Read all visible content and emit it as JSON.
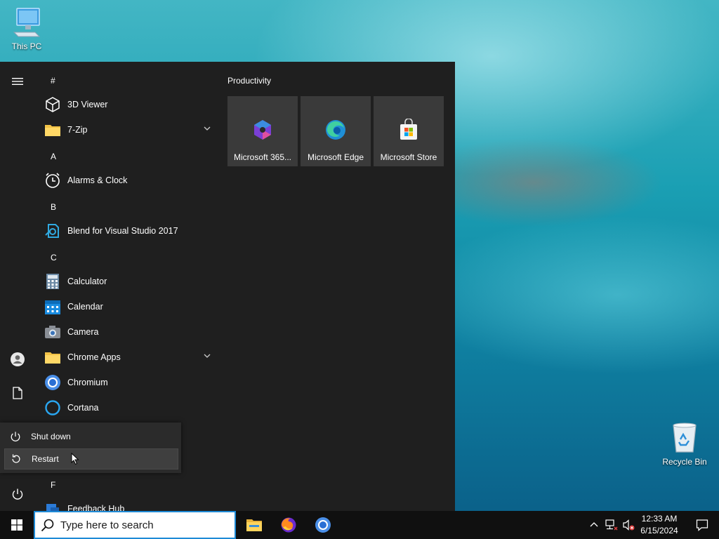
{
  "desktop": {
    "icons": [
      {
        "label": "This PC",
        "icon": "computer-icon"
      },
      {
        "label": "Recycle Bin",
        "icon": "recycle-bin-icon"
      }
    ]
  },
  "start_menu": {
    "rail": {
      "menu_icon": "hamburger-icon",
      "user_icon": "user-icon",
      "documents_icon": "document-icon",
      "power_icon": "power-icon"
    },
    "app_list": {
      "letters": [
        "#",
        "A",
        "B",
        "C",
        "F"
      ],
      "apps": [
        {
          "name": "3D Viewer",
          "icon": "cube-icon"
        },
        {
          "name": "7-Zip",
          "icon": "folder-icon",
          "expandable": true
        },
        {
          "name": "Alarms & Clock",
          "icon": "alarm-clock-icon"
        },
        {
          "name": "Blend for Visual Studio 2017",
          "icon": "blend-icon"
        },
        {
          "name": "Calculator",
          "icon": "calculator-icon"
        },
        {
          "name": "Calendar",
          "icon": "calendar-icon"
        },
        {
          "name": "Camera",
          "icon": "camera-icon"
        },
        {
          "name": "Chrome Apps",
          "icon": "folder-icon",
          "expandable": true
        },
        {
          "name": "Chromium",
          "icon": "chromium-icon"
        },
        {
          "name": "Cortana",
          "icon": "cortana-icon"
        },
        {
          "name": "Feedback Hub",
          "icon": "feedback-hub-icon"
        }
      ]
    },
    "tiles": {
      "group_title": "Productivity",
      "items": [
        {
          "label": "Microsoft 365...",
          "icon": "microsoft-365-icon"
        },
        {
          "label": "Microsoft Edge",
          "icon": "edge-icon"
        },
        {
          "label": "Microsoft Store",
          "icon": "store-icon"
        }
      ]
    },
    "power_menu": {
      "items": [
        {
          "label": "Shut down",
          "icon": "power-icon"
        },
        {
          "label": "Restart",
          "icon": "restart-icon",
          "hovered": true
        }
      ]
    }
  },
  "taskbar": {
    "start_icon": "windows-logo-icon",
    "search": {
      "placeholder": "Type here to search",
      "value": ""
    },
    "pinned": [
      {
        "name": "File Explorer",
        "icon": "file-explorer-icon"
      },
      {
        "name": "Firefox",
        "icon": "firefox-icon"
      },
      {
        "name": "Chromium",
        "icon": "chromium-icon"
      }
    ],
    "tray": {
      "icons": [
        "chevron-up-icon",
        "network-icon",
        "volume-muted-icon"
      ],
      "time": "12:33 AM",
      "date": "6/15/2024",
      "notification_icon": "notification-icon"
    }
  },
  "colors": {
    "start_bg": "#1f1f1f",
    "tile_bg": "#3a3a3a",
    "taskbar_bg": "#101010",
    "search_border": "#1e8ad6",
    "accent": "#0078d7"
  }
}
